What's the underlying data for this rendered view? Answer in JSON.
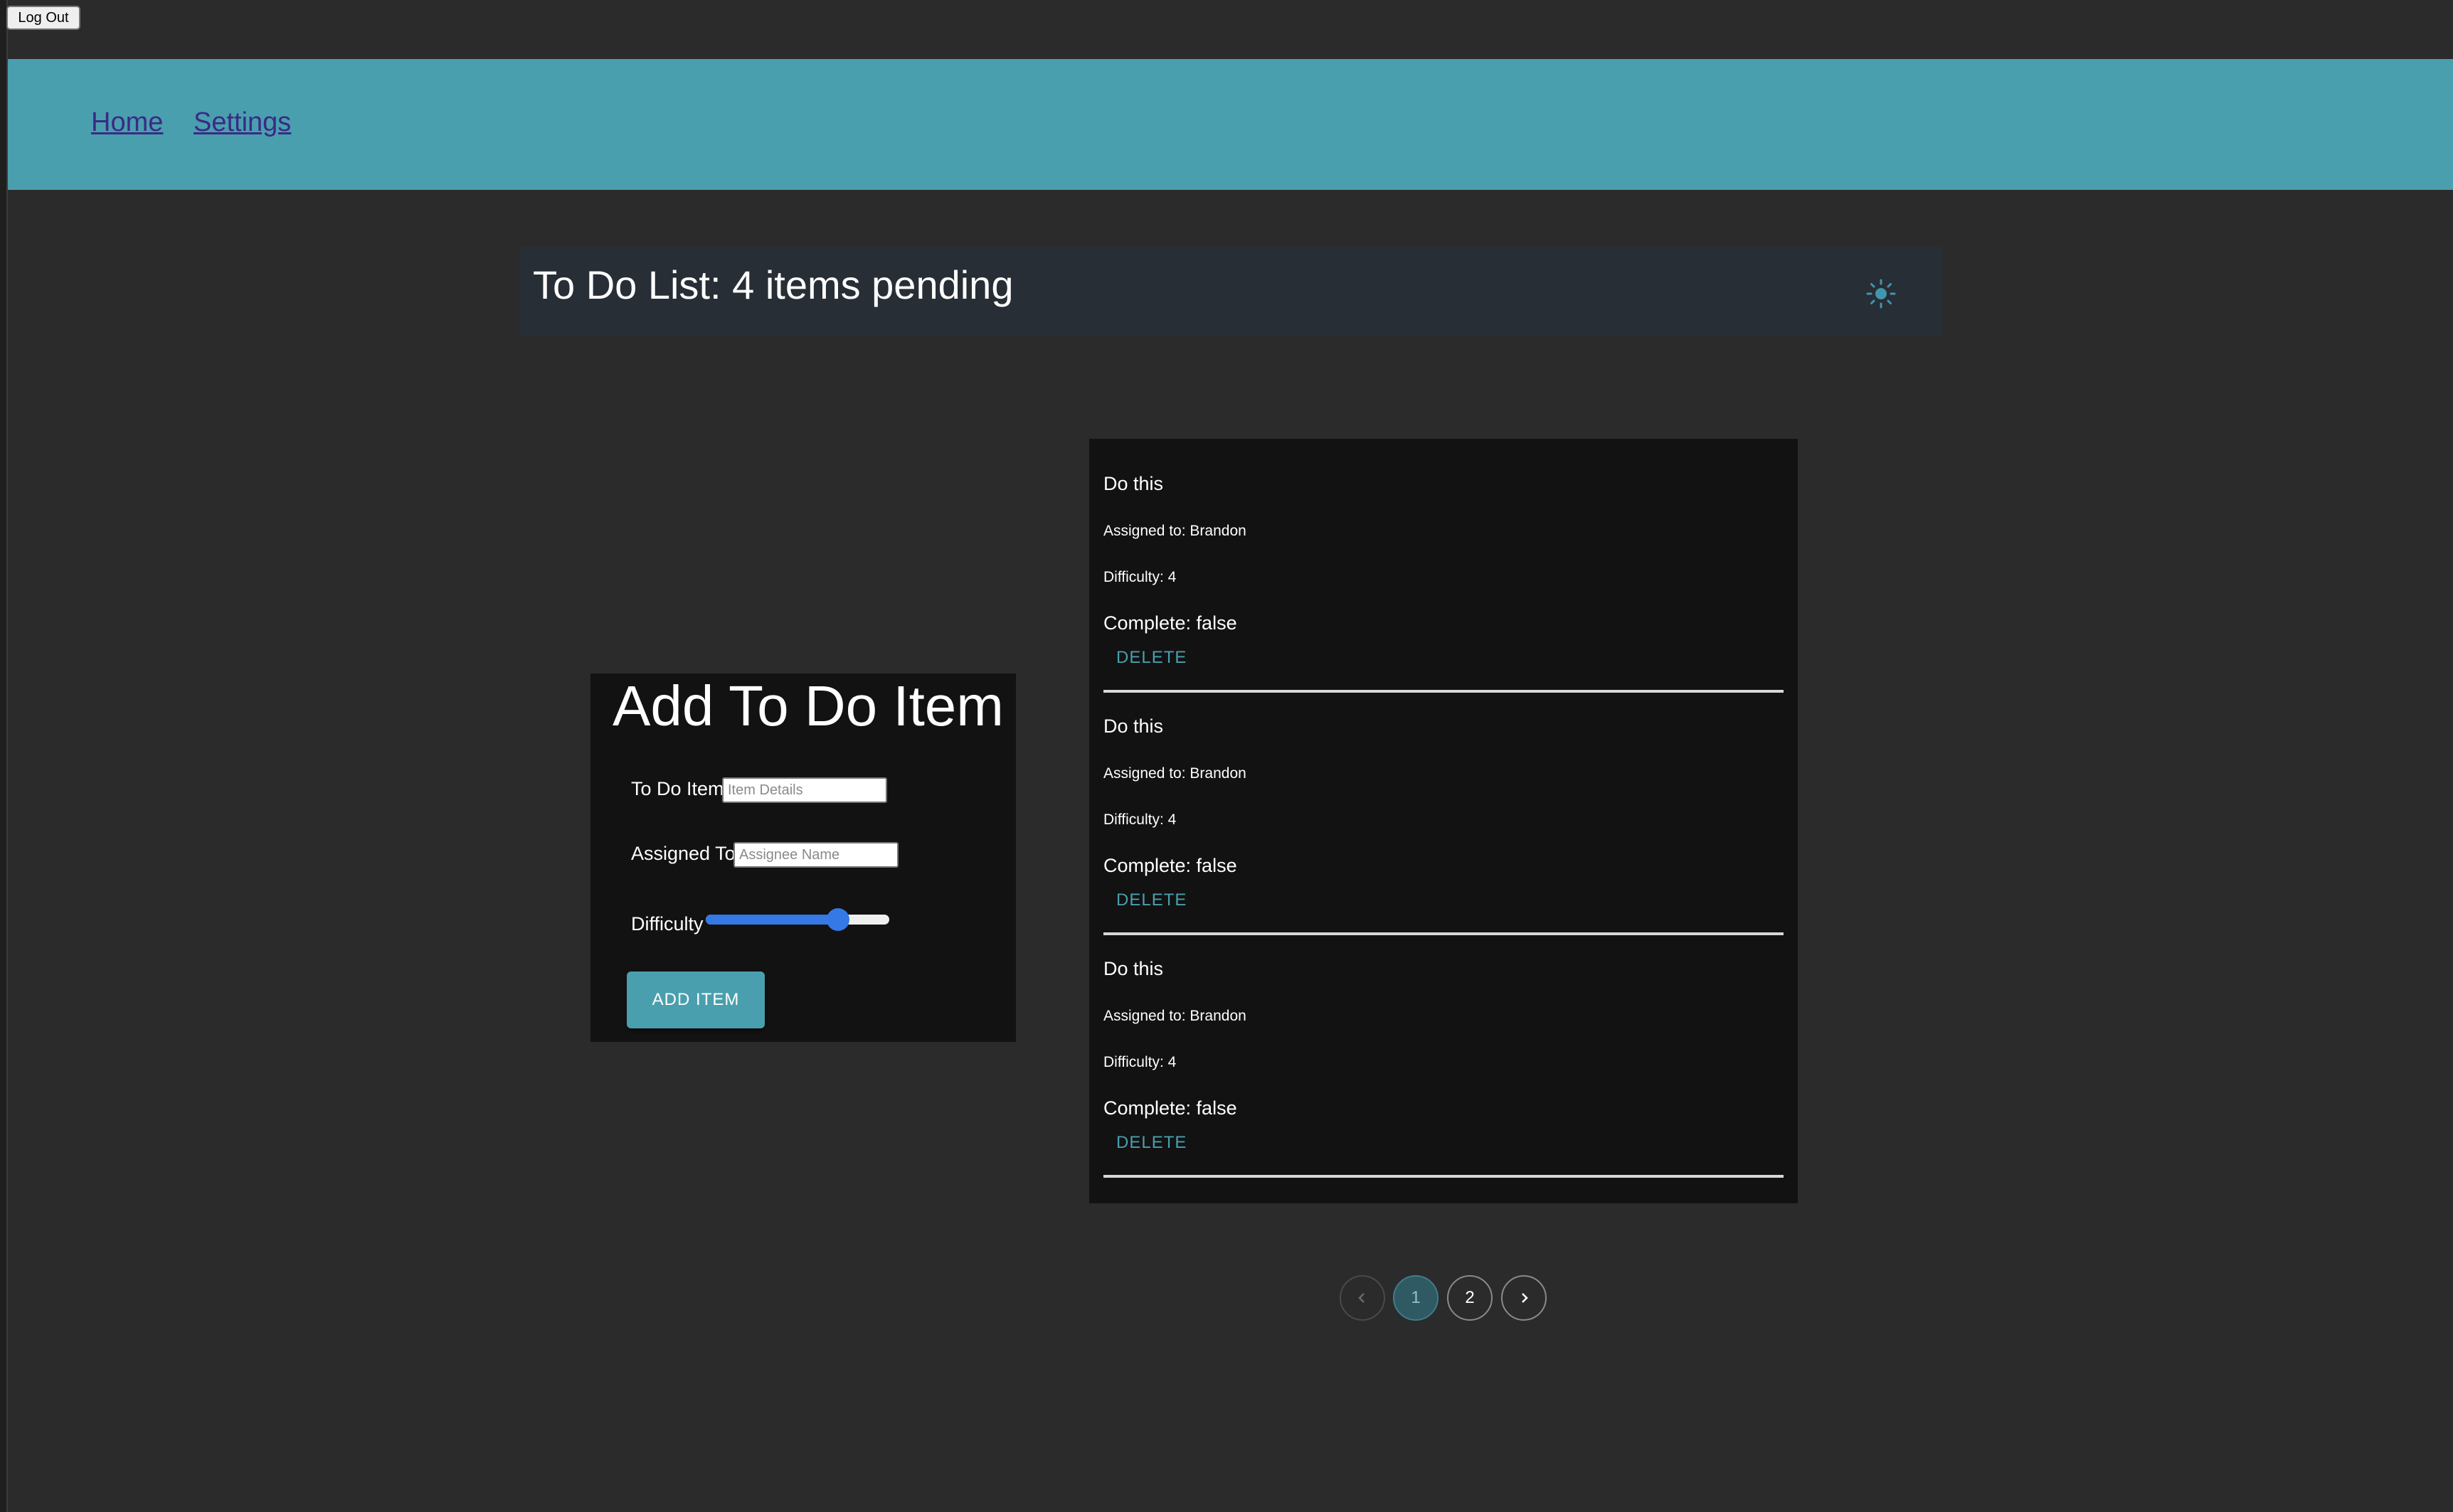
{
  "auth": {
    "logout_label": "Log Out"
  },
  "nav": {
    "home_label": "Home",
    "settings_label": "Settings"
  },
  "header": {
    "title": "To Do List: 4 items pending",
    "theme_toggle_icon": "sun-icon"
  },
  "form": {
    "title": "Add To Do Item",
    "item_label": "To Do Item",
    "item_placeholder": "Item Details",
    "assignee_label": "Assigned To",
    "assignee_placeholder": "Assignee Name",
    "difficulty_label": "Difficulty",
    "difficulty_level_fraction": 0.72,
    "submit_label": "ADD ITEM"
  },
  "todos": [
    {
      "text": "Do this",
      "assigned": "Assigned to: Brandon",
      "difficulty": "Difficulty: 4",
      "complete": "Complete: false",
      "delete_label": "DELETE"
    },
    {
      "text": "Do this",
      "assigned": "Assigned to: Brandon",
      "difficulty": "Difficulty: 4",
      "complete": "Complete: false",
      "delete_label": "DELETE"
    },
    {
      "text": "Do this",
      "assigned": "Assigned to: Brandon",
      "difficulty": "Difficulty: 4",
      "complete": "Complete: false",
      "delete_label": "DELETE"
    }
  ],
  "pagination": {
    "prev_icon": "chevron-left-icon",
    "pages": [
      "1",
      "2"
    ],
    "current_page": "1",
    "next_icon": "chevron-right-icon"
  },
  "colors": {
    "background": "#2b2b2b",
    "header": "#4a9fae",
    "accent": "#4a9fae",
    "card": "#121212",
    "slider": "#3479e5"
  }
}
